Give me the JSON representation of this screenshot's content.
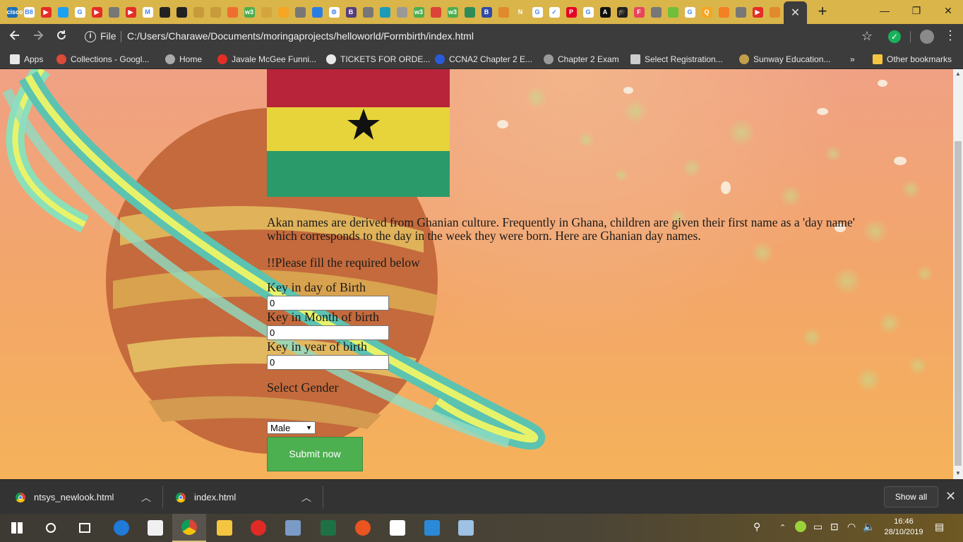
{
  "browser": {
    "active_tab_close": "✕",
    "new_tab": "+",
    "window_controls": {
      "minimize": "—",
      "maximize": "❐",
      "close": "✕"
    },
    "omnibox": {
      "scheme_label": "File",
      "url": "C:/Users/Charawe/Documents/moringaprojects/helloworld/Formbirth/index.html"
    }
  },
  "favicons": [
    {
      "icon": "cisco-icon",
      "color": "#1d6fb8",
      "text": "cisco"
    },
    {
      "icon": "b8-icon",
      "color": "#ffffff",
      "text": "B8"
    },
    {
      "icon": "youtube-icon",
      "color": "#e52d27",
      "text": "▶"
    },
    {
      "icon": "twitter-icon",
      "color": "#1da1f2",
      "text": ""
    },
    {
      "icon": "google-icon",
      "color": "#ffffff",
      "text": "G"
    },
    {
      "icon": "youtube-icon",
      "color": "#e52d27",
      "text": "▶"
    },
    {
      "icon": "globe-icon",
      "color": "#777777",
      "text": ""
    },
    {
      "icon": "youtube-icon",
      "color": "#e52d27",
      "text": "▶"
    },
    {
      "icon": "gmail-icon",
      "color": "#ffffff",
      "text": "M"
    },
    {
      "icon": "github-icon",
      "color": "#222222",
      "text": ""
    },
    {
      "icon": "github-icon",
      "color": "#222222",
      "text": ""
    },
    {
      "icon": "tree-icon",
      "color": "#c79a3a",
      "text": ""
    },
    {
      "icon": "tree-icon",
      "color": "#c79a3a",
      "text": ""
    },
    {
      "icon": "diamond-icon",
      "color": "#f06d2f",
      "text": ""
    },
    {
      "icon": "w3-icon",
      "color": "#4caf50",
      "text": "w3"
    },
    {
      "icon": "sketch-icon",
      "color": "#d4a53c",
      "text": ""
    },
    {
      "icon": "bookmark-icon",
      "color": "#f5a623",
      "text": ""
    },
    {
      "icon": "globe-icon",
      "color": "#777777",
      "text": ""
    },
    {
      "icon": "edge-icon",
      "color": "#2a7de1",
      "text": ""
    },
    {
      "icon": "gear-icon",
      "color": "#ffffff",
      "text": "⚙"
    },
    {
      "icon": "b-icon",
      "color": "#563d7c",
      "text": "B"
    },
    {
      "icon": "globe-icon",
      "color": "#777777",
      "text": ""
    },
    {
      "icon": "cap-icon",
      "color": "#1a9bb8",
      "text": ""
    },
    {
      "icon": "globe-icon",
      "color": "#999999",
      "text": ""
    },
    {
      "icon": "w3-icon",
      "color": "#4caf50",
      "text": "w3"
    },
    {
      "icon": "chrome-icon",
      "color": "#db4437",
      "text": ""
    },
    {
      "icon": "w3-icon",
      "color": "#4caf50",
      "text": "w3"
    },
    {
      "icon": "shell-icon",
      "color": "#2e8b57",
      "text": ""
    },
    {
      "icon": "b-icon",
      "color": "#2f4aa8",
      "text": "B"
    },
    {
      "icon": "leaf-icon",
      "color": "#e08a2c",
      "text": ""
    },
    {
      "icon": "n-icon",
      "color": "#dab54a",
      "text": "N"
    },
    {
      "icon": "google-icon",
      "color": "#ffffff",
      "text": "G"
    },
    {
      "icon": "check-icon",
      "color": "#ffffff",
      "text": "✓"
    },
    {
      "icon": "pinterest-icon",
      "color": "#e60023",
      "text": "P"
    },
    {
      "icon": "google-icon",
      "color": "#ffffff",
      "text": "G"
    },
    {
      "icon": "a-icon",
      "color": "#111111",
      "text": "A"
    },
    {
      "icon": "mortarboard-icon",
      "color": "#222222",
      "text": "🎓"
    },
    {
      "icon": "f-icon",
      "color": "#e8445a",
      "text": "F"
    },
    {
      "icon": "globe-icon",
      "color": "#777777",
      "text": ""
    },
    {
      "icon": "leaf-icon",
      "color": "#6fbf3a",
      "text": ""
    },
    {
      "icon": "google-icon",
      "color": "#ffffff",
      "text": "G"
    },
    {
      "icon": "q-icon",
      "color": "#f5a623",
      "text": "Q"
    },
    {
      "icon": "stack-icon",
      "color": "#f48024",
      "text": ""
    },
    {
      "icon": "globe-icon",
      "color": "#777777",
      "text": ""
    },
    {
      "icon": "youtube-icon",
      "color": "#e52d27",
      "text": "▶"
    },
    {
      "icon": "leaf-icon",
      "color": "#e08a2c",
      "text": ""
    }
  ],
  "bookmarks": [
    {
      "label": "Apps",
      "icon": "apps-grid-icon",
      "color": "#e8e8e8"
    },
    {
      "label": "Collections - Googl...",
      "icon": "google-plus-icon",
      "color": "#dd4b39"
    },
    {
      "label": "Home",
      "icon": "home-bird-icon",
      "color": "#aaaaaa"
    },
    {
      "label": "Javale McGee Funni...",
      "icon": "youtube-icon",
      "color": "#e52d27"
    },
    {
      "label": "TICKETS FOR ORDE...",
      "icon": "globe-icon",
      "color": "#e8e8e8"
    },
    {
      "label": "CCNA2 Chapter 2 E...",
      "icon": "ccna-icon",
      "color": "#2a5bd7"
    },
    {
      "label": "Chapter 2 Exam",
      "icon": "cisco-icon",
      "color": "#9a9a9a"
    },
    {
      "label": "Select Registration...",
      "icon": "document-icon",
      "color": "#cccccc"
    },
    {
      "label": "Sunway Education...",
      "icon": "crest-icon",
      "color": "#c2a04a"
    },
    {
      "label": "»",
      "icon": "overflow-icon",
      "color": "#e8e8e8"
    },
    {
      "label": "Other bookmarks",
      "icon": "folder-icon",
      "color": "#f5c542"
    }
  ],
  "page": {
    "intro": "Akan names are derived from Ghanian culture. Frequently in Ghana, children are given their first name as a 'day name' which corresponds to the day in the week they were born. Here are Ghanian day names.",
    "notice": "!!Please fill the required below",
    "form": {
      "day_label": "Key in day of Birth",
      "day_value": "0",
      "month_label": "Key in Month of birth",
      "month_value": "0",
      "year_label": "Key in year of birth",
      "year_value": "0",
      "gender_label": "Select Gender",
      "gender_selected": "Male",
      "gender_arrow": "▼",
      "submit": "Submit now"
    },
    "flag_colors": {
      "red": "#b8243a",
      "gold": "#e6d43a",
      "green": "#2b9a6a",
      "star": "#111111"
    }
  },
  "downloads": {
    "items": [
      {
        "name": "ntsys_newlook.html"
      },
      {
        "name": "index.html"
      }
    ],
    "show_all": "Show all",
    "close": "✕",
    "chevron": "︿"
  },
  "taskbar": {
    "time": "16:46",
    "date": "28/10/2019",
    "apps": [
      {
        "icon": "windows-start-icon"
      },
      {
        "icon": "search-icon"
      },
      {
        "icon": "task-view-icon"
      },
      {
        "icon": "edge-icon"
      },
      {
        "icon": "store-icon"
      },
      {
        "icon": "chrome-icon"
      },
      {
        "icon": "file-explorer-icon"
      },
      {
        "icon": "opera-icon"
      },
      {
        "icon": "remote-desktop-icon"
      },
      {
        "icon": "excel-icon"
      },
      {
        "icon": "ubuntu-icon"
      },
      {
        "icon": "mail-icon"
      },
      {
        "icon": "vscode-icon"
      },
      {
        "icon": "notes-icon"
      }
    ]
  }
}
